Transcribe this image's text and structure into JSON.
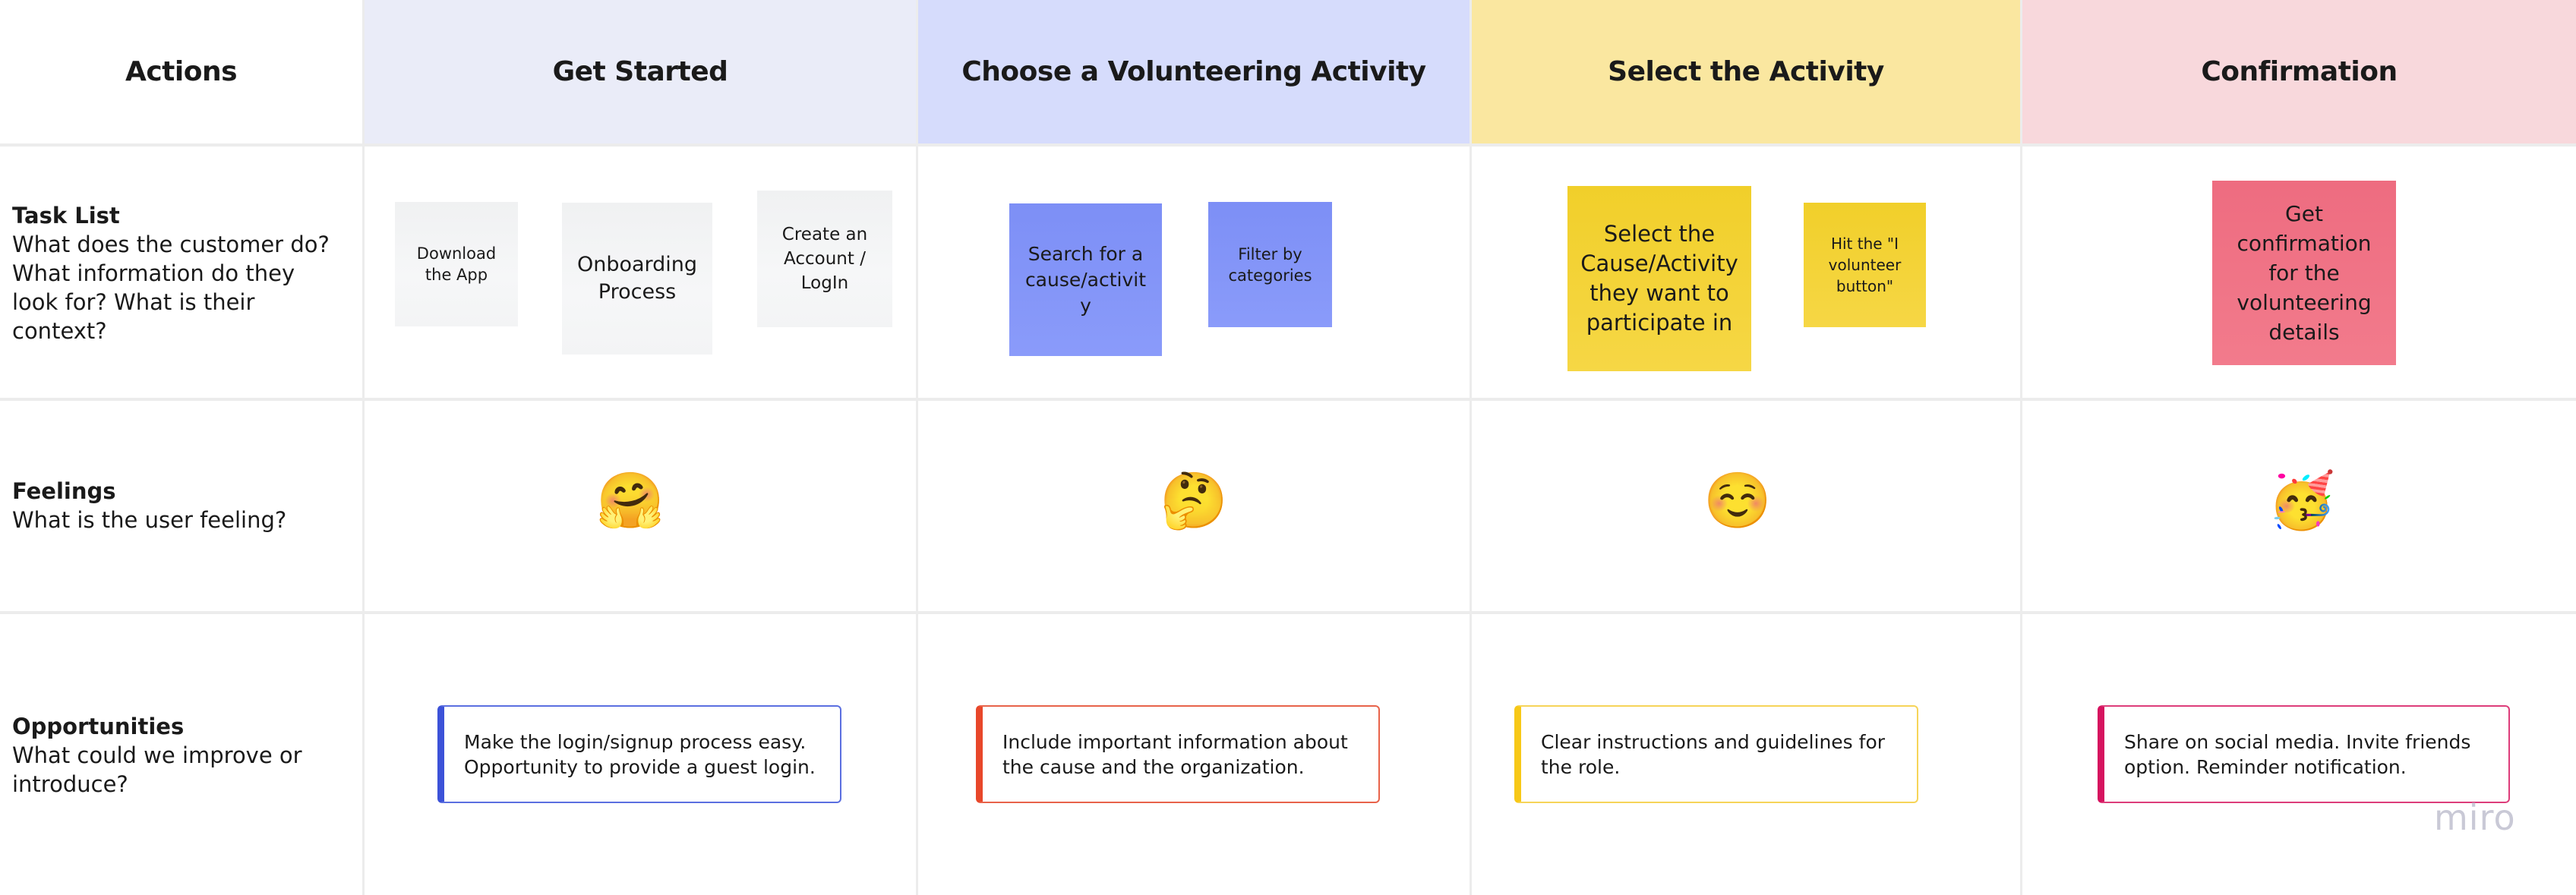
{
  "board": {
    "columns": [
      {
        "key": "actions",
        "title": "Actions",
        "header_color": "#ffffff"
      },
      {
        "key": "get_started",
        "title": "Get Started",
        "header_color": "#eaecf8"
      },
      {
        "key": "choose",
        "title": "Choose a Volunteering Activity",
        "header_color": "#d6dcfc"
      },
      {
        "key": "select",
        "title": "Select the Activity",
        "header_color": "#fae7a0"
      },
      {
        "key": "confirm",
        "title": "Confirmation",
        "header_color": "#f8d8dc"
      }
    ],
    "rows": {
      "task_list": {
        "title": "Task List",
        "description": "What does the customer do? What information do they look for? What is their context?"
      },
      "feelings": {
        "title": "Feelings",
        "description": "What is the user feeling?"
      },
      "opportunities": {
        "title": "Opportunities",
        "description": "What could we improve or introduce?"
      }
    },
    "stickies": [
      {
        "text": "Download the App",
        "color": "white"
      },
      {
        "text": "Onboarding Process",
        "color": "white"
      },
      {
        "text": "Create an Account / LogIn",
        "color": "white"
      },
      {
        "text": "Search for a cause/activity",
        "color": "blue"
      },
      {
        "text": "Filter by categories",
        "color": "blue"
      },
      {
        "text": "Select the Cause/Activity they want to participate in",
        "color": "yellow"
      },
      {
        "text": "Hit the \"I volunteer button\"",
        "color": "yellow"
      },
      {
        "text": "Get confirmation for the volunteering details",
        "color": "pink"
      }
    ],
    "feelings": [
      {
        "emoji": "🤗",
        "name": "hugging-face"
      },
      {
        "emoji": "🤔",
        "name": "thinking-face"
      },
      {
        "emoji": "☺️",
        "name": "smiling-face"
      },
      {
        "emoji": "🥳",
        "name": "partying-face"
      }
    ],
    "opportunities": [
      {
        "text": "Make the login/signup process easy. Opportunity to provide a guest login.",
        "accent": "#3c52d8"
      },
      {
        "text": "Include important information about the cause and the organization.",
        "accent": "#e8472a"
      },
      {
        "text": "Clear instructions and guidelines for the role.",
        "accent": "#f7c817"
      },
      {
        "text": "Share on social media. Invite friends option. Reminder notification.",
        "accent": "#d6135f"
      }
    ],
    "logo": "miro"
  }
}
